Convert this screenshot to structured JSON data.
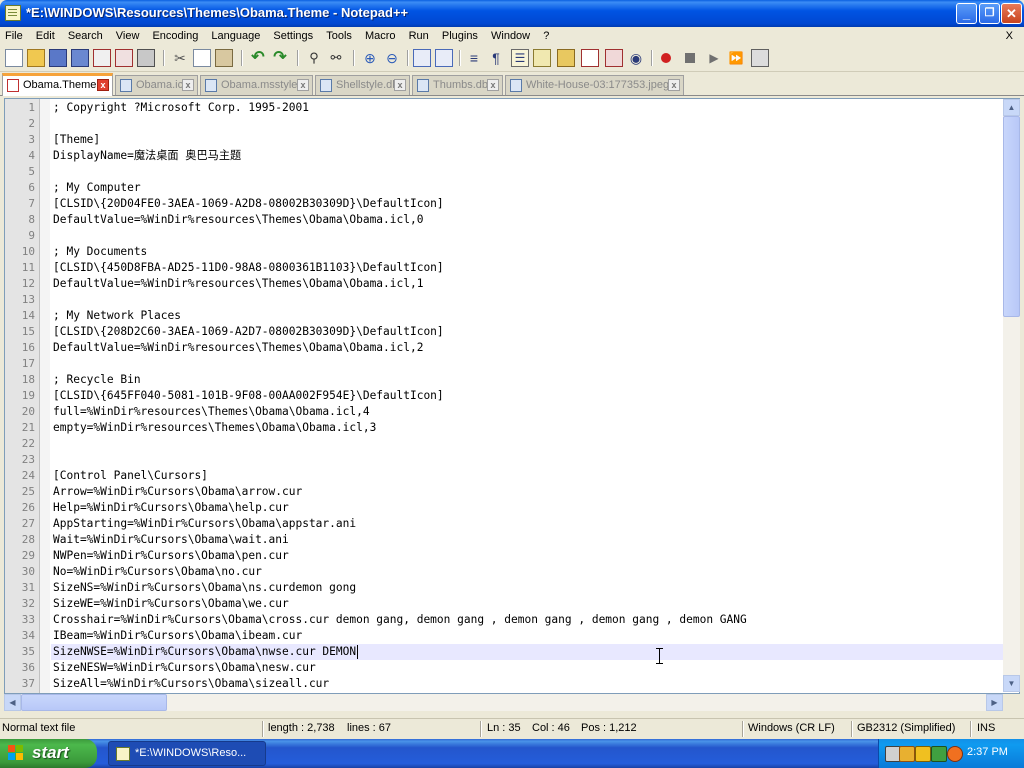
{
  "window": {
    "title": "*E:\\WINDOWS\\Resources\\Themes\\Obama.Theme - Notepad++",
    "minimize_glyph": "_",
    "maximize_glyph": "❐",
    "close_glyph": "✕"
  },
  "menu": {
    "items": [
      "File",
      "Edit",
      "Search",
      "View",
      "Encoding",
      "Language",
      "Settings",
      "Tools",
      "Macro",
      "Run",
      "Plugins",
      "Window",
      "?"
    ],
    "close_glyph": "X"
  },
  "tabs": [
    {
      "label": "Obama.Theme",
      "active": true
    },
    {
      "label": "Obama.icl",
      "active": false
    },
    {
      "label": "Obama.msstyles",
      "active": false
    },
    {
      "label": "Shellstyle.dll",
      "active": false
    },
    {
      "label": "Thumbs.db",
      "active": false
    },
    {
      "label": "White-House-03:177353.jpeg",
      "active": false
    }
  ],
  "editor": {
    "current_line": 35,
    "current_col": 46,
    "lines": [
      "; Copyright ?Microsoft Corp. 1995-2001",
      "",
      "[Theme]",
      "DisplayName=魔法桌面 奥巴马主题",
      "",
      "; My Computer",
      "[CLSID\\{20D04FE0-3AEA-1069-A2D8-08002B30309D}\\DefaultIcon]",
      "DefaultValue=%WinDir%resources\\Themes\\Obama\\Obama.icl,0",
      "",
      "; My Documents",
      "[CLSID\\{450D8FBA-AD25-11D0-98A8-0800361B1103}\\DefaultIcon]",
      "DefaultValue=%WinDir%resources\\Themes\\Obama\\Obama.icl,1",
      "",
      "; My Network Places",
      "[CLSID\\{208D2C60-3AEA-1069-A2D7-08002B30309D}\\DefaultIcon]",
      "DefaultValue=%WinDir%resources\\Themes\\Obama\\Obama.icl,2",
      "",
      "; Recycle Bin",
      "[CLSID\\{645FF040-5081-101B-9F08-00AA002F954E}\\DefaultIcon]",
      "full=%WinDir%resources\\Themes\\Obama\\Obama.icl,4",
      "empty=%WinDir%resources\\Themes\\Obama\\Obama.icl,3",
      "",
      "",
      "[Control Panel\\Cursors]",
      "Arrow=%WinDir%Cursors\\Obama\\arrow.cur",
      "Help=%WinDir%Cursors\\Obama\\help.cur",
      "AppStarting=%WinDir%Cursors\\Obama\\appstar.ani",
      "Wait=%WinDir%Cursors\\Obama\\wait.ani",
      "NWPen=%WinDir%Cursors\\Obama\\pen.cur",
      "No=%WinDir%Cursors\\Obama\\no.cur",
      "SizeNS=%WinDir%Cursors\\Obama\\ns.curdemon gong",
      "SizeWE=%WinDir%Cursors\\Obama\\we.cur",
      "Crosshair=%WinDir%Cursors\\Obama\\cross.cur demon gang, demon gang , demon gang , demon gang , demon GANG",
      "IBeam=%WinDir%Cursors\\Obama\\ibeam.cur",
      "SizeNWSE=%WinDir%Cursors\\Obama\\nwse.cur DEMON",
      "SizeNESW=%WinDir%Cursors\\Obama\\nesw.cur",
      "SizeAll=%WinDir%Cursors\\Obama\\sizeall.cur"
    ]
  },
  "statusbar": {
    "file_type": "Normal text file",
    "length": "length : 2,738",
    "lines": "lines : 67",
    "ln": "Ln : 35",
    "col": "Col : 46",
    "pos": "Pos : 1,212",
    "eol": "Windows (CR LF)",
    "encoding": "GB2312 (Simplified)",
    "mode": "INS"
  },
  "taskbar": {
    "start_label": "start",
    "task_label": "*E:\\WINDOWS\\Reso...",
    "clock": "2:37 PM"
  },
  "colors": {
    "titlebar": "#0054e3",
    "active_tab_accent": "#f6a33a",
    "current_line": "#e8e8ff",
    "taskbar": "#245ddb",
    "start_button": "#3a9a3a"
  }
}
